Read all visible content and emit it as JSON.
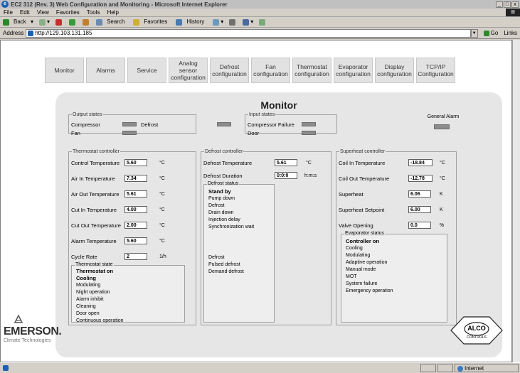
{
  "window": {
    "title": "EC2 312 (Rev. 3) Web Configuration and Monitoring - Microsoft Internet Explorer",
    "controls": [
      "_",
      "□",
      "x"
    ]
  },
  "menubar": [
    "File",
    "Edit",
    "View",
    "Favorites",
    "Tools",
    "Help"
  ],
  "toolbar": {
    "back": "Back",
    "search": "Search",
    "favorites": "Favorites",
    "history": "History"
  },
  "address": {
    "label": "Address",
    "url": "http://129.103.131.185",
    "go": "Go",
    "links": "Links"
  },
  "status": {
    "left": "",
    "zone": "Internet"
  },
  "nav": [
    {
      "label": "Monitor"
    },
    {
      "label": "Alarms"
    },
    {
      "label": "Service"
    },
    {
      "label": "Analog sensor configuration"
    },
    {
      "label": "Defrost configuration"
    },
    {
      "label": "Fan configuration"
    },
    {
      "label": "Thermostat configuration"
    },
    {
      "label": "Evaporator configuration"
    },
    {
      "label": "Display configuration"
    },
    {
      "label": "TCP/IP Configuration"
    }
  ],
  "page": {
    "title": "Monitor",
    "output_states": {
      "legend": "Output states",
      "compressor": "Compressor",
      "defrost": "Defrost",
      "fan": "Fan"
    },
    "input_states": {
      "legend": "Input states",
      "compressor_failure": "Compressor Failure",
      "door": "Door"
    },
    "general_alarm": "General Alarm",
    "thermostat": {
      "legend": "Thermostat controller",
      "rows": [
        {
          "label": "Control Temperature",
          "value": "5.60",
          "unit": "°C"
        },
        {
          "label": "Air In Temperature",
          "value": "7.34",
          "unit": "°C"
        },
        {
          "label": "Air Out Temperature",
          "value": "5.61",
          "unit": "°C"
        },
        {
          "label": "Cut In Temperature",
          "value": "4.00",
          "unit": "°C"
        },
        {
          "label": "Cut Out Temperature",
          "value": "2.00",
          "unit": "°C"
        },
        {
          "label": "Alarm Temperature",
          "value": "5.60",
          "unit": "°C"
        },
        {
          "label": "Cycle Rate",
          "value": "2",
          "unit": "1/h"
        }
      ],
      "state_legend": "Thermostat state",
      "states": [
        {
          "label": "Thermostat on",
          "bold": true
        },
        {
          "label": "Cooling",
          "bold": true
        },
        {
          "label": "Modulating",
          "bold": false
        },
        {
          "label": "Night operation",
          "bold": false
        },
        {
          "label": "Alarm inhibit",
          "bold": false
        },
        {
          "label": "Cleaning",
          "bold": false
        },
        {
          "label": "Door open",
          "bold": false
        },
        {
          "label": "Continuous operation",
          "bold": false
        }
      ]
    },
    "defrost": {
      "legend": "Defrost controller",
      "rows": [
        {
          "label": "Defrost Temperature",
          "value": "5.61",
          "unit": "°C"
        },
        {
          "label": "Defrost Duration",
          "value": "0:0:0",
          "unit": "h:m:s"
        }
      ],
      "status_legend": "Defrost status",
      "states": [
        {
          "label": "Stand by",
          "bold": true
        },
        {
          "label": "Pump down",
          "bold": false
        },
        {
          "label": "Defrost",
          "bold": false
        },
        {
          "label": "Drain down",
          "bold": false
        },
        {
          "label": "Injection delay",
          "bold": false
        },
        {
          "label": "Synchronization wait",
          "bold": false
        }
      ],
      "states2": [
        {
          "label": "Defrost",
          "bold": false
        },
        {
          "label": "Pulsed defrost",
          "bold": false
        },
        {
          "label": "Demand defrost",
          "bold": false
        }
      ]
    },
    "superheat": {
      "legend": "Superheat controller",
      "rows": [
        {
          "label": "Coil In Temperature",
          "value": "-18.84",
          "unit": "°C"
        },
        {
          "label": "Coil Out Temperature",
          "value": "-12.78",
          "unit": "°C"
        },
        {
          "label": "Superheat",
          "value": "6.06",
          "unit": "K"
        },
        {
          "label": "Superheat Setpoint",
          "value": "6.00",
          "unit": "K"
        },
        {
          "label": "Valve Opening",
          "value": "0.0",
          "unit": "%"
        }
      ],
      "status_legend": "Evaporator status",
      "states": [
        {
          "label": "Controller on",
          "bold": true
        },
        {
          "label": "Cooling",
          "bold": false
        },
        {
          "label": "Modulating",
          "bold": false
        },
        {
          "label": "Adaptive operation",
          "bold": false
        },
        {
          "label": "Manual mode",
          "bold": false
        },
        {
          "label": "MOT",
          "bold": false
        },
        {
          "label": "System failure",
          "bold": false
        },
        {
          "label": "Emergency operation",
          "bold": false
        }
      ]
    },
    "brand": {
      "name": "EMERSON.",
      "sub": "Climate Technologies",
      "alco": "ALCO",
      "alco_sub": "CONTROLS"
    }
  }
}
